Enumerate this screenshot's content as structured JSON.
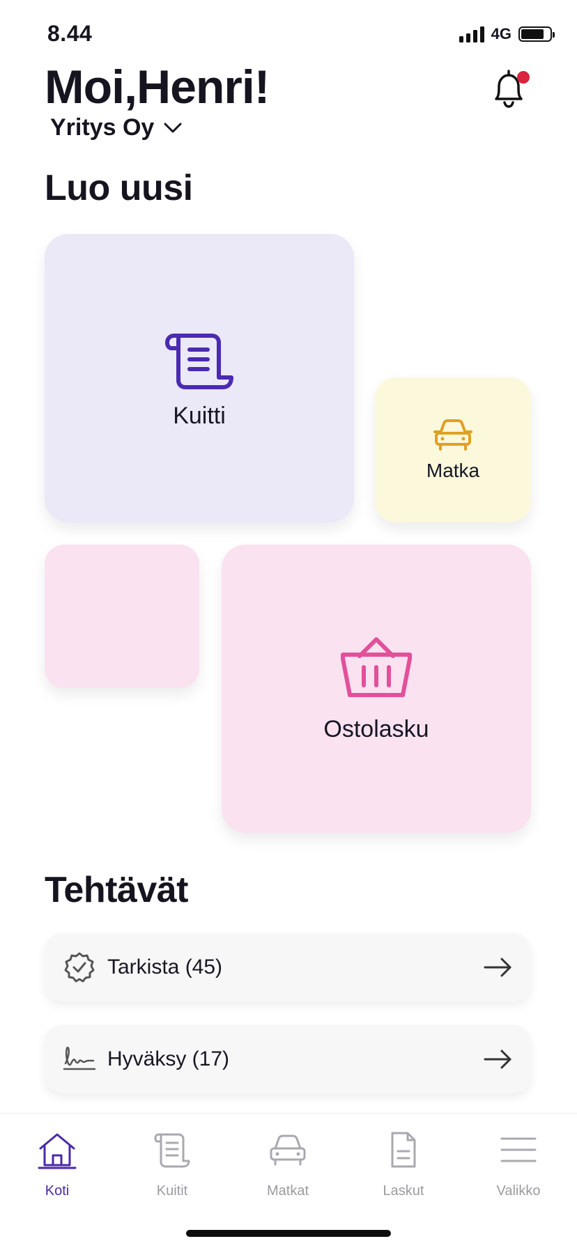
{
  "status_bar": {
    "time": "8.44",
    "network": "4G",
    "battery_level": 0.8
  },
  "header": {
    "greeting": "Moi,Henri!",
    "company": "Yritys Oy",
    "notification_badge": true
  },
  "create_section": {
    "title": "Luo uusi",
    "tiles": {
      "kuitti": "Kuitti",
      "matka": "Matka",
      "ostolasku": "Ostolasku"
    }
  },
  "tasks_section": {
    "title": "Tehtävät",
    "items": [
      {
        "label": "Tarkista (45)",
        "icon": "verified-badge-icon"
      },
      {
        "label": "Hyväksy (17)",
        "icon": "signature-icon"
      }
    ]
  },
  "tabbar": {
    "tabs": [
      {
        "label": "Koti",
        "icon": "home-icon",
        "active": true
      },
      {
        "label": "Kuitit",
        "icon": "receipt-icon",
        "active": false
      },
      {
        "label": "Matkat",
        "icon": "car-icon",
        "active": false
      },
      {
        "label": "Laskut",
        "icon": "document-icon",
        "active": false
      },
      {
        "label": "Valikko",
        "icon": "menu-icon",
        "active": false
      }
    ]
  },
  "colors": {
    "accent_purple": "#4a2aa7",
    "kuitti_tile": "#ebe8f7",
    "matka_tile": "#fbf8dc",
    "ostolasku_tile": "#fae2f0",
    "kuitti_icon": "#4a2bb0",
    "matka_icon": "#e0a020",
    "ostolasku_icon": "#e2509a",
    "notification_dot": "#d8243f"
  }
}
